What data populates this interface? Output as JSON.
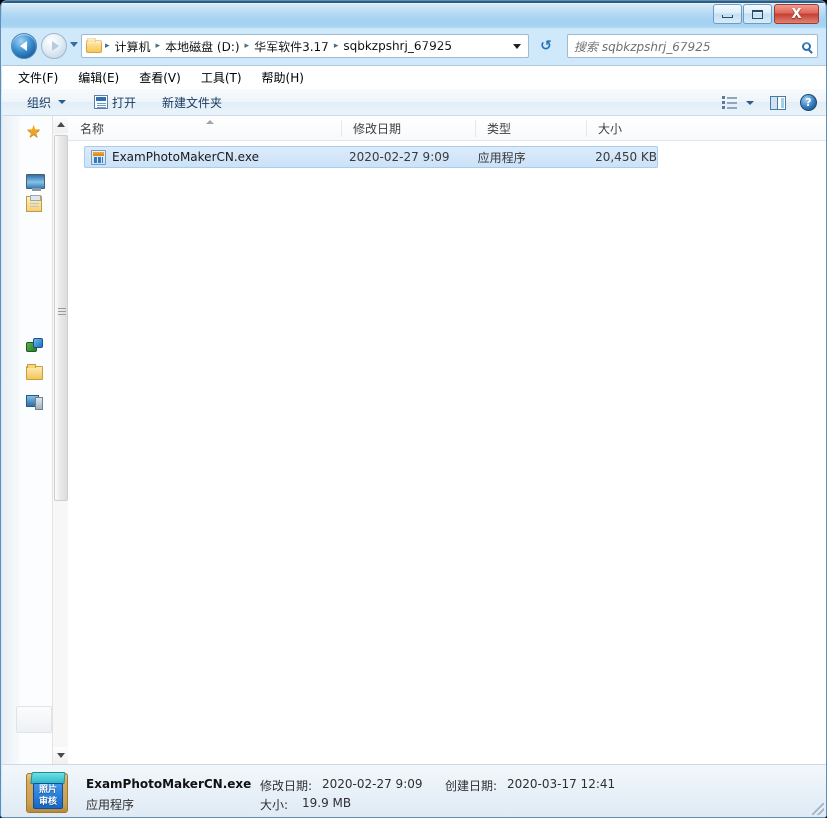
{
  "window": {
    "controls": {
      "minimize_label": "–",
      "maximize_label": "□",
      "close_label": "X"
    }
  },
  "address_bar": {
    "crumbs": [
      {
        "label": "计算机"
      },
      {
        "label": "本地磁盘 (D:)"
      },
      {
        "label": "华军软件3.17"
      },
      {
        "label": "sqbkzpshrj_67925"
      }
    ],
    "separator": "▸",
    "refresh_glyph": "↺"
  },
  "search": {
    "placeholder": "搜索 sqbkzpshrj_67925"
  },
  "menu": {
    "items": [
      {
        "label": "文件(F)"
      },
      {
        "label": "编辑(E)"
      },
      {
        "label": "查看(V)"
      },
      {
        "label": "工具(T)"
      },
      {
        "label": "帮助(H)"
      }
    ]
  },
  "toolbar": {
    "organize_label": "组织",
    "open_label": "打开",
    "new_folder_label": "新建文件夹",
    "help_glyph": "?"
  },
  "columns": [
    {
      "key": "name",
      "label": "名称"
    },
    {
      "key": "date",
      "label": "修改日期"
    },
    {
      "key": "type",
      "label": "类型"
    },
    {
      "key": "size",
      "label": "大小"
    }
  ],
  "files": [
    {
      "name": "ExamPhotoMakerCN.exe",
      "date": "2020-02-27 9:09",
      "type": "应用程序",
      "size": "20,450 KB",
      "selected": true
    }
  ],
  "details": {
    "icon_text_line1": "照片",
    "icon_text_line2": "审核",
    "name": "ExamPhotoMakerCN.exe",
    "modified_label": "修改日期:",
    "modified_value": "2020-02-27 9:09",
    "created_label": "创建日期:",
    "created_value": "2020-03-17 12:41",
    "type": "应用程序",
    "size_label": "大小:",
    "size_value": "19.9 MB"
  },
  "colors": {
    "titlebar_blue": "#9ecdf0",
    "selection_blue": "#cbe2f8",
    "close_red": "#c33f30",
    "accent_text": "#173a5e"
  }
}
